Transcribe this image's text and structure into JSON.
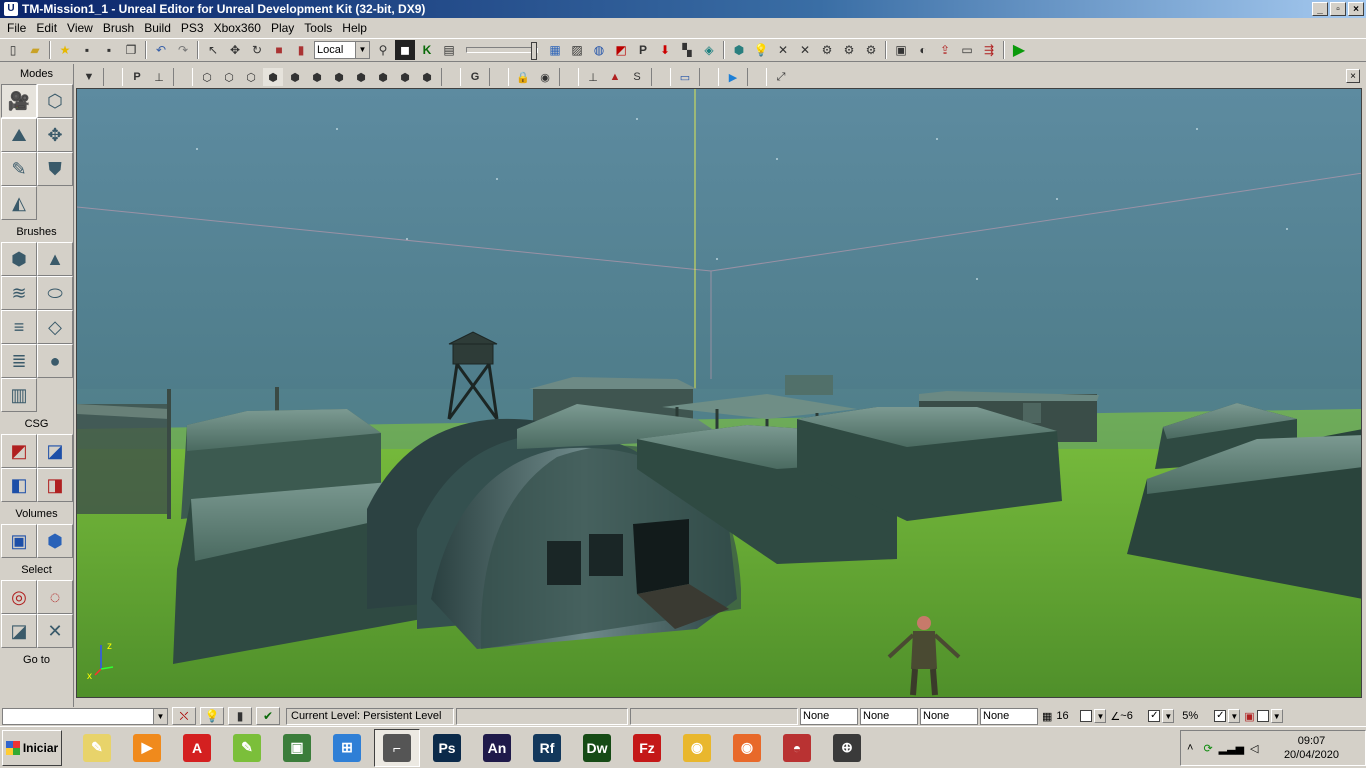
{
  "window": {
    "title": "TM-Mission1_1 - Unreal Editor for Unreal Development Kit (32-bit, DX9)",
    "controls": [
      "_",
      "▫",
      "×"
    ]
  },
  "menu": [
    "File",
    "Edit",
    "View",
    "Brush",
    "Build",
    "PS3",
    "Xbox360",
    "Play",
    "Tools",
    "Help"
  ],
  "toolbar": {
    "transform_mode": "Local",
    "icons": [
      "new-file-icon",
      "open-folder-icon",
      "favorite-icon",
      "save-icon",
      "save-all-icon",
      "copy-icon",
      "undo-icon",
      "redo-icon",
      "select-arrow-icon",
      "translate-icon",
      "rotate-icon",
      "scale-icon",
      "nonuniform-scale-icon",
      "search-binoculars-icon",
      "matinee-icon",
      "kismet-icon",
      "clapper-icon",
      "content-browser-icon",
      "build-lighting-icon",
      "build-paths-icon",
      "play-in-editor-icon",
      "play-icon"
    ]
  },
  "modes_panel": {
    "sections": [
      {
        "title": "Modes",
        "icons": [
          "camera-mode-icon",
          "geometry-mode-icon",
          "terrain-mode-icon",
          "texture-align-icon",
          "mesh-paint-icon",
          "foliage-icon",
          "landscape-icon"
        ]
      },
      {
        "title": "Brushes",
        "icons": [
          "cube-brush-icon",
          "cone-brush-icon",
          "curved-stair-icon",
          "cylinder-brush-icon",
          "linear-stair-icon",
          "sheet-brush-icon",
          "spiral-stair-icon",
          "sphere-brush-icon",
          "volumetric-brush-icon"
        ]
      },
      {
        "title": "CSG",
        "icons": [
          "csg-add-icon",
          "csg-subtract-icon",
          "csg-intersect-icon",
          "csg-deintersect-icon"
        ]
      },
      {
        "title": "Volumes",
        "icons": [
          "add-volume-icon",
          "volume-cube-icon"
        ]
      },
      {
        "title": "Select",
        "icons": [
          "show-selected-icon",
          "hide-selected-icon",
          "show-all-icon",
          "invert-selection-icon"
        ]
      },
      {
        "title": "Go to",
        "icons": []
      }
    ]
  },
  "viewport": {
    "axis_labels": {
      "x": "x",
      "z": "z"
    }
  },
  "statusbar": {
    "current_level_label": "Current Level:",
    "current_level_value": "Persistent Level",
    "none_fields": [
      "None",
      "None",
      "None",
      "None"
    ],
    "grid_snap": "16",
    "rotation_snap": "~6",
    "scale_snap": "5%"
  },
  "taskbar": {
    "start_label": "Iniciar",
    "apps": [
      {
        "name": "notepad",
        "text": "✎",
        "color": "#e8d36a"
      },
      {
        "name": "media-player",
        "text": "▶",
        "color": "#f08a1c"
      },
      {
        "name": "pdf-reader",
        "text": "A",
        "color": "#d42020"
      },
      {
        "name": "notes",
        "text": "✎",
        "color": "#7bbf3a"
      },
      {
        "name": "network",
        "text": "▣",
        "color": "#3b7d3b"
      },
      {
        "name": "windows",
        "text": "⊞",
        "color": "#2f7fd6"
      },
      {
        "name": "unreal-editor",
        "text": "⌐",
        "color": "#555555"
      },
      {
        "name": "photoshop",
        "text": "Ps",
        "color": "#0b2a4a"
      },
      {
        "name": "animate",
        "text": "An",
        "color": "#1f1a4a"
      },
      {
        "name": "reflector",
        "text": "Rf",
        "color": "#13385c"
      },
      {
        "name": "dreamweaver",
        "text": "Dw",
        "color": "#164b16"
      },
      {
        "name": "filezilla",
        "text": "Fz",
        "color": "#c41818"
      },
      {
        "name": "chrome",
        "text": "◉",
        "color": "#e9b72d"
      },
      {
        "name": "firefox",
        "text": "◉",
        "color": "#e8692a"
      },
      {
        "name": "cake-app",
        "text": "◓",
        "color": "#b93232"
      },
      {
        "name": "3ds-max",
        "text": "⊕",
        "color": "#3a3a3a"
      }
    ],
    "clock_time": "09:07",
    "clock_date": "20/04/2020"
  },
  "colors": {
    "title_start": "#0a246a",
    "sky_top": "#5d8ba0",
    "sky_bottom": "#4e7d8c",
    "ground_near": "#4f8f2a",
    "ground_far": "#7bbf3e",
    "tent": "#3c5a50",
    "tent_roof": "#6f8e86"
  }
}
